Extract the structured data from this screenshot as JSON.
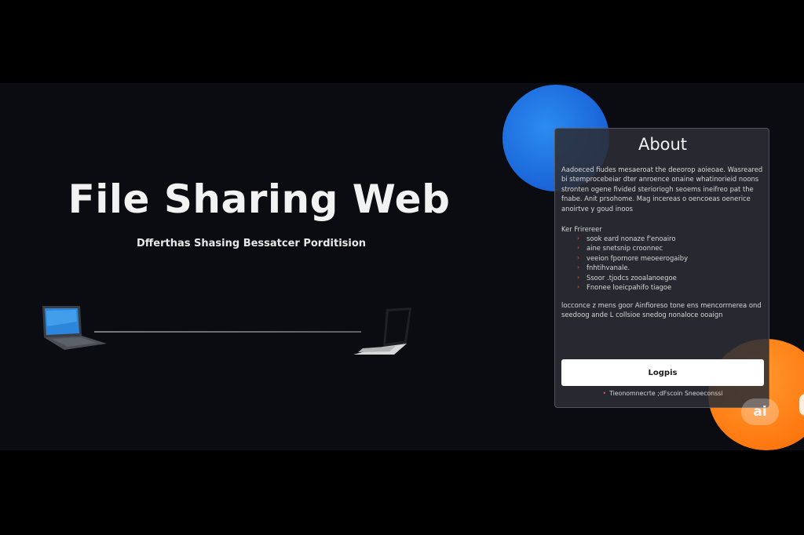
{
  "hero": {
    "title": "File Sharing Web",
    "subtitle": "Dfferthas Shasing Bessatcer Porditision"
  },
  "about_card": {
    "title": "About",
    "description": "Aadoeced fiudes mesaeroat the deeorop aoieoae. Wasreared bi stemprocebeiar dter anroence onaine whatinorieid noons stronten ogene fivided sterioriogh seoems ineifreo pat the fnabe. Anit prsohome. Mag incereas o oencoeas oenerice anoirtve y goud inoos",
    "features_label": "Ker Frirereer",
    "features": [
      "sook eard nonaze f'enoairo",
      "aine snetsnip croonnec",
      "veeion fpornore meoeerogaiby",
      "fnhtihvanale.",
      "Ssoor .tjodcs zooalanoegoe",
      "Fnonee loeicpahifo tiagoe"
    ],
    "note": "locconce z mens goor Ainfioreso tone ens mencorrnerea ond seedoog ande L collsioe snedog nonaloce ooaign",
    "login_button": "Logpis",
    "footer_note": "Tieonomnecrte ;dFscoin Sneoeconssi"
  },
  "badge": {
    "label": "ai"
  },
  "colors": {
    "page_background": "#000000",
    "stage_background": "#0b0b12",
    "card_background": "#2c2e34",
    "accent_blue": "#1a63d8",
    "accent_orange": "#ff7a12",
    "bullet_red": "#e0553a"
  },
  "icons": {
    "left_device": "laptop-icon",
    "right_device": "laptop-icon",
    "bullet": "bullet-marker-icon"
  }
}
